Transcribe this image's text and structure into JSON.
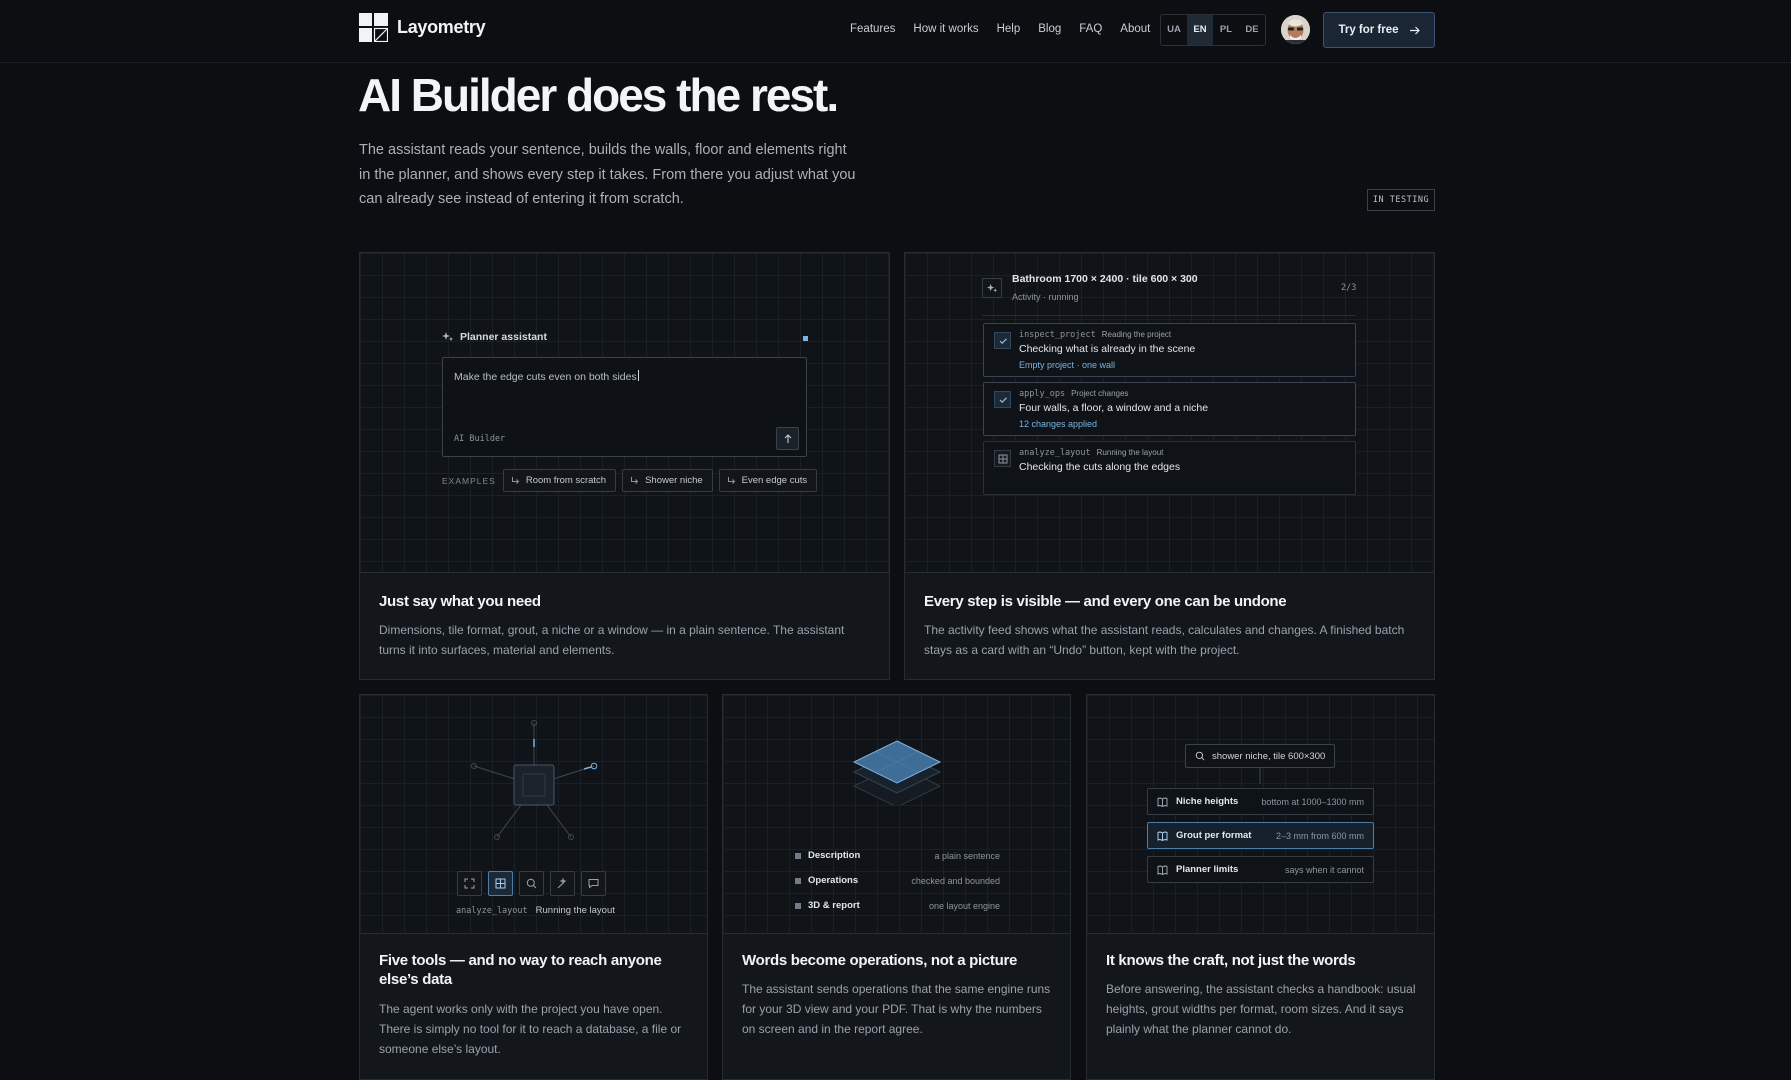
{
  "brand": {
    "name": "Layometry"
  },
  "nav": {
    "items": [
      "Features",
      "How it works",
      "Help",
      "Blog",
      "FAQ",
      "About"
    ]
  },
  "languages": {
    "items": [
      "UA",
      "EN",
      "PL",
      "DE"
    ],
    "active": "EN"
  },
  "header": {
    "cta_label": "Try for free"
  },
  "hero": {
    "title": "AI Builder does the rest.",
    "description": "The assistant reads your sentence, builds the walls, floor and elements right in the planner, and shows every step it takes. From there you adjust what you can already see instead of entering it from scratch.",
    "badge": "IN TESTING"
  },
  "cards": {
    "c1": {
      "title": "Just say what you need",
      "text": "Dimensions, tile format, grout, a niche or a window — in a plain sentence. The assistant turns it into surfaces, material and elements.",
      "assistant_label": "Planner assistant",
      "prompt": "Make the edge cuts even on both sides",
      "prompt_label": "AI Builder",
      "examples_label": "EXAMPLES",
      "examples": [
        "Room from scratch",
        "Shower niche",
        "Even edge cuts"
      ]
    },
    "c2": {
      "title": "Every step is visible — and every one can be undone",
      "text": "The activity feed shows what the assistant reads, calculates and changes. A finished batch stays as a card with an “Undo” button, kept with the project.",
      "activity_title": "Bathroom 1700 × 2400 · tile 600 × 300",
      "activity_status": "Activity · running",
      "counter": "2/3",
      "steps": [
        {
          "tool": "inspect_project",
          "tag": "Reading the project",
          "main": "Checking what is already in the scene",
          "result": "Empty project · one wall"
        },
        {
          "tool": "apply_ops",
          "tag": "Project changes",
          "main": "Four walls, a floor, a window and a niche",
          "result": "12 changes applied"
        },
        {
          "tool": "analyze_layout",
          "tag": "Running the layout",
          "main": "Checking the cuts along the edges",
          "result": ""
        }
      ]
    },
    "c3": {
      "title": "Five tools — and no way to reach anyone else’s data",
      "text": "The agent works only with the project you have open. There is simply no tool for it to reach a database, a file or someone else’s layout.",
      "tool_name": "analyze_layout",
      "tool_status": "Running the layout"
    },
    "c4": {
      "title": "Words become operations, not a picture",
      "text": "The assistant sends operations that the same engine runs for your 3D view and your PDF. That is why the numbers on screen and in the report agree.",
      "ops": [
        {
          "label": "Description",
          "value": "a plain sentence"
        },
        {
          "label": "Operations",
          "value": "checked and bounded"
        },
        {
          "label": "3D & report",
          "value": "one layout engine"
        }
      ]
    },
    "c5": {
      "title": "It knows the craft, not just the words",
      "text": "Before answering, the assistant checks a handbook: usual heights, grout widths per format, room sizes. And it says plainly what the planner cannot do.",
      "query": "shower niche, tile 600×300",
      "entries": [
        {
          "label": "Niche heights",
          "value": "bottom at 1000–1300 mm"
        },
        {
          "label": "Grout per format",
          "value": "2–3 mm from 600 mm"
        },
        {
          "label": "Planner limits",
          "value": "says when it cannot"
        }
      ]
    }
  },
  "colors": {
    "background": "#0c0e11",
    "accent": "#79b3e0",
    "card": "#13171c"
  }
}
